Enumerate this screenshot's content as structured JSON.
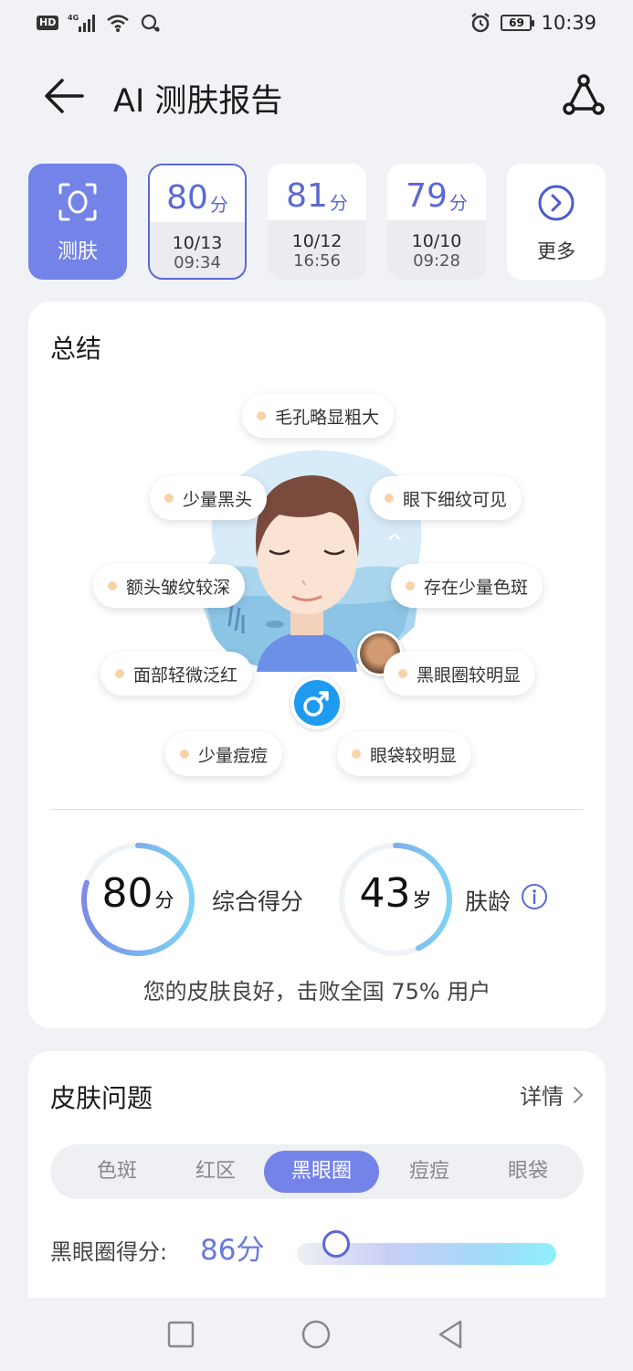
{
  "status_bar": {
    "network_badge": "HD",
    "network_type": "4G",
    "battery": "69",
    "time": "10:39"
  },
  "header": {
    "title": "AI 测肤报告"
  },
  "history": {
    "scan_label": "测肤",
    "records": [
      {
        "score": "80",
        "unit": "分",
        "date": "10/13",
        "time": "09:34",
        "selected": true
      },
      {
        "score": "81",
        "unit": "分",
        "date": "10/12",
        "time": "16:56",
        "selected": false
      },
      {
        "score": "79",
        "unit": "分",
        "date": "10/10",
        "time": "09:28",
        "selected": false
      }
    ],
    "more_label": "更多"
  },
  "summary": {
    "title": "总结",
    "tags": [
      "毛孔略显粗大",
      "少量黑头",
      "眼下细纹可见",
      "额头皱纹较深",
      "存在少量色斑",
      "面部轻微泛红",
      "黑眼圈较明显",
      "少量痘痘",
      "眼袋较明显"
    ],
    "gender_icon": "male-icon",
    "overall": {
      "value": "80",
      "unit": "分",
      "label": "综合得分",
      "progress": 0.8
    },
    "skin_age": {
      "value": "43",
      "unit": "岁",
      "label": "肤龄",
      "progress": 0.43
    },
    "conclusion": "您的皮肤良好，击败全国 75% 用户"
  },
  "issues": {
    "title": "皮肤问题",
    "details_label": "详情",
    "tabs": [
      "色斑",
      "红区",
      "黑眼圈",
      "痘痘",
      "眼袋"
    ],
    "active_tab": "黑眼圈",
    "score_label": "黑眼圈得分:",
    "score_value": "86分",
    "score_fraction": 0.15
  },
  "colors": {
    "accent": "#7483e8",
    "score_blue": "#5a69d2",
    "background": "#f1f2f6",
    "gender_blue": "#1e9aef"
  }
}
